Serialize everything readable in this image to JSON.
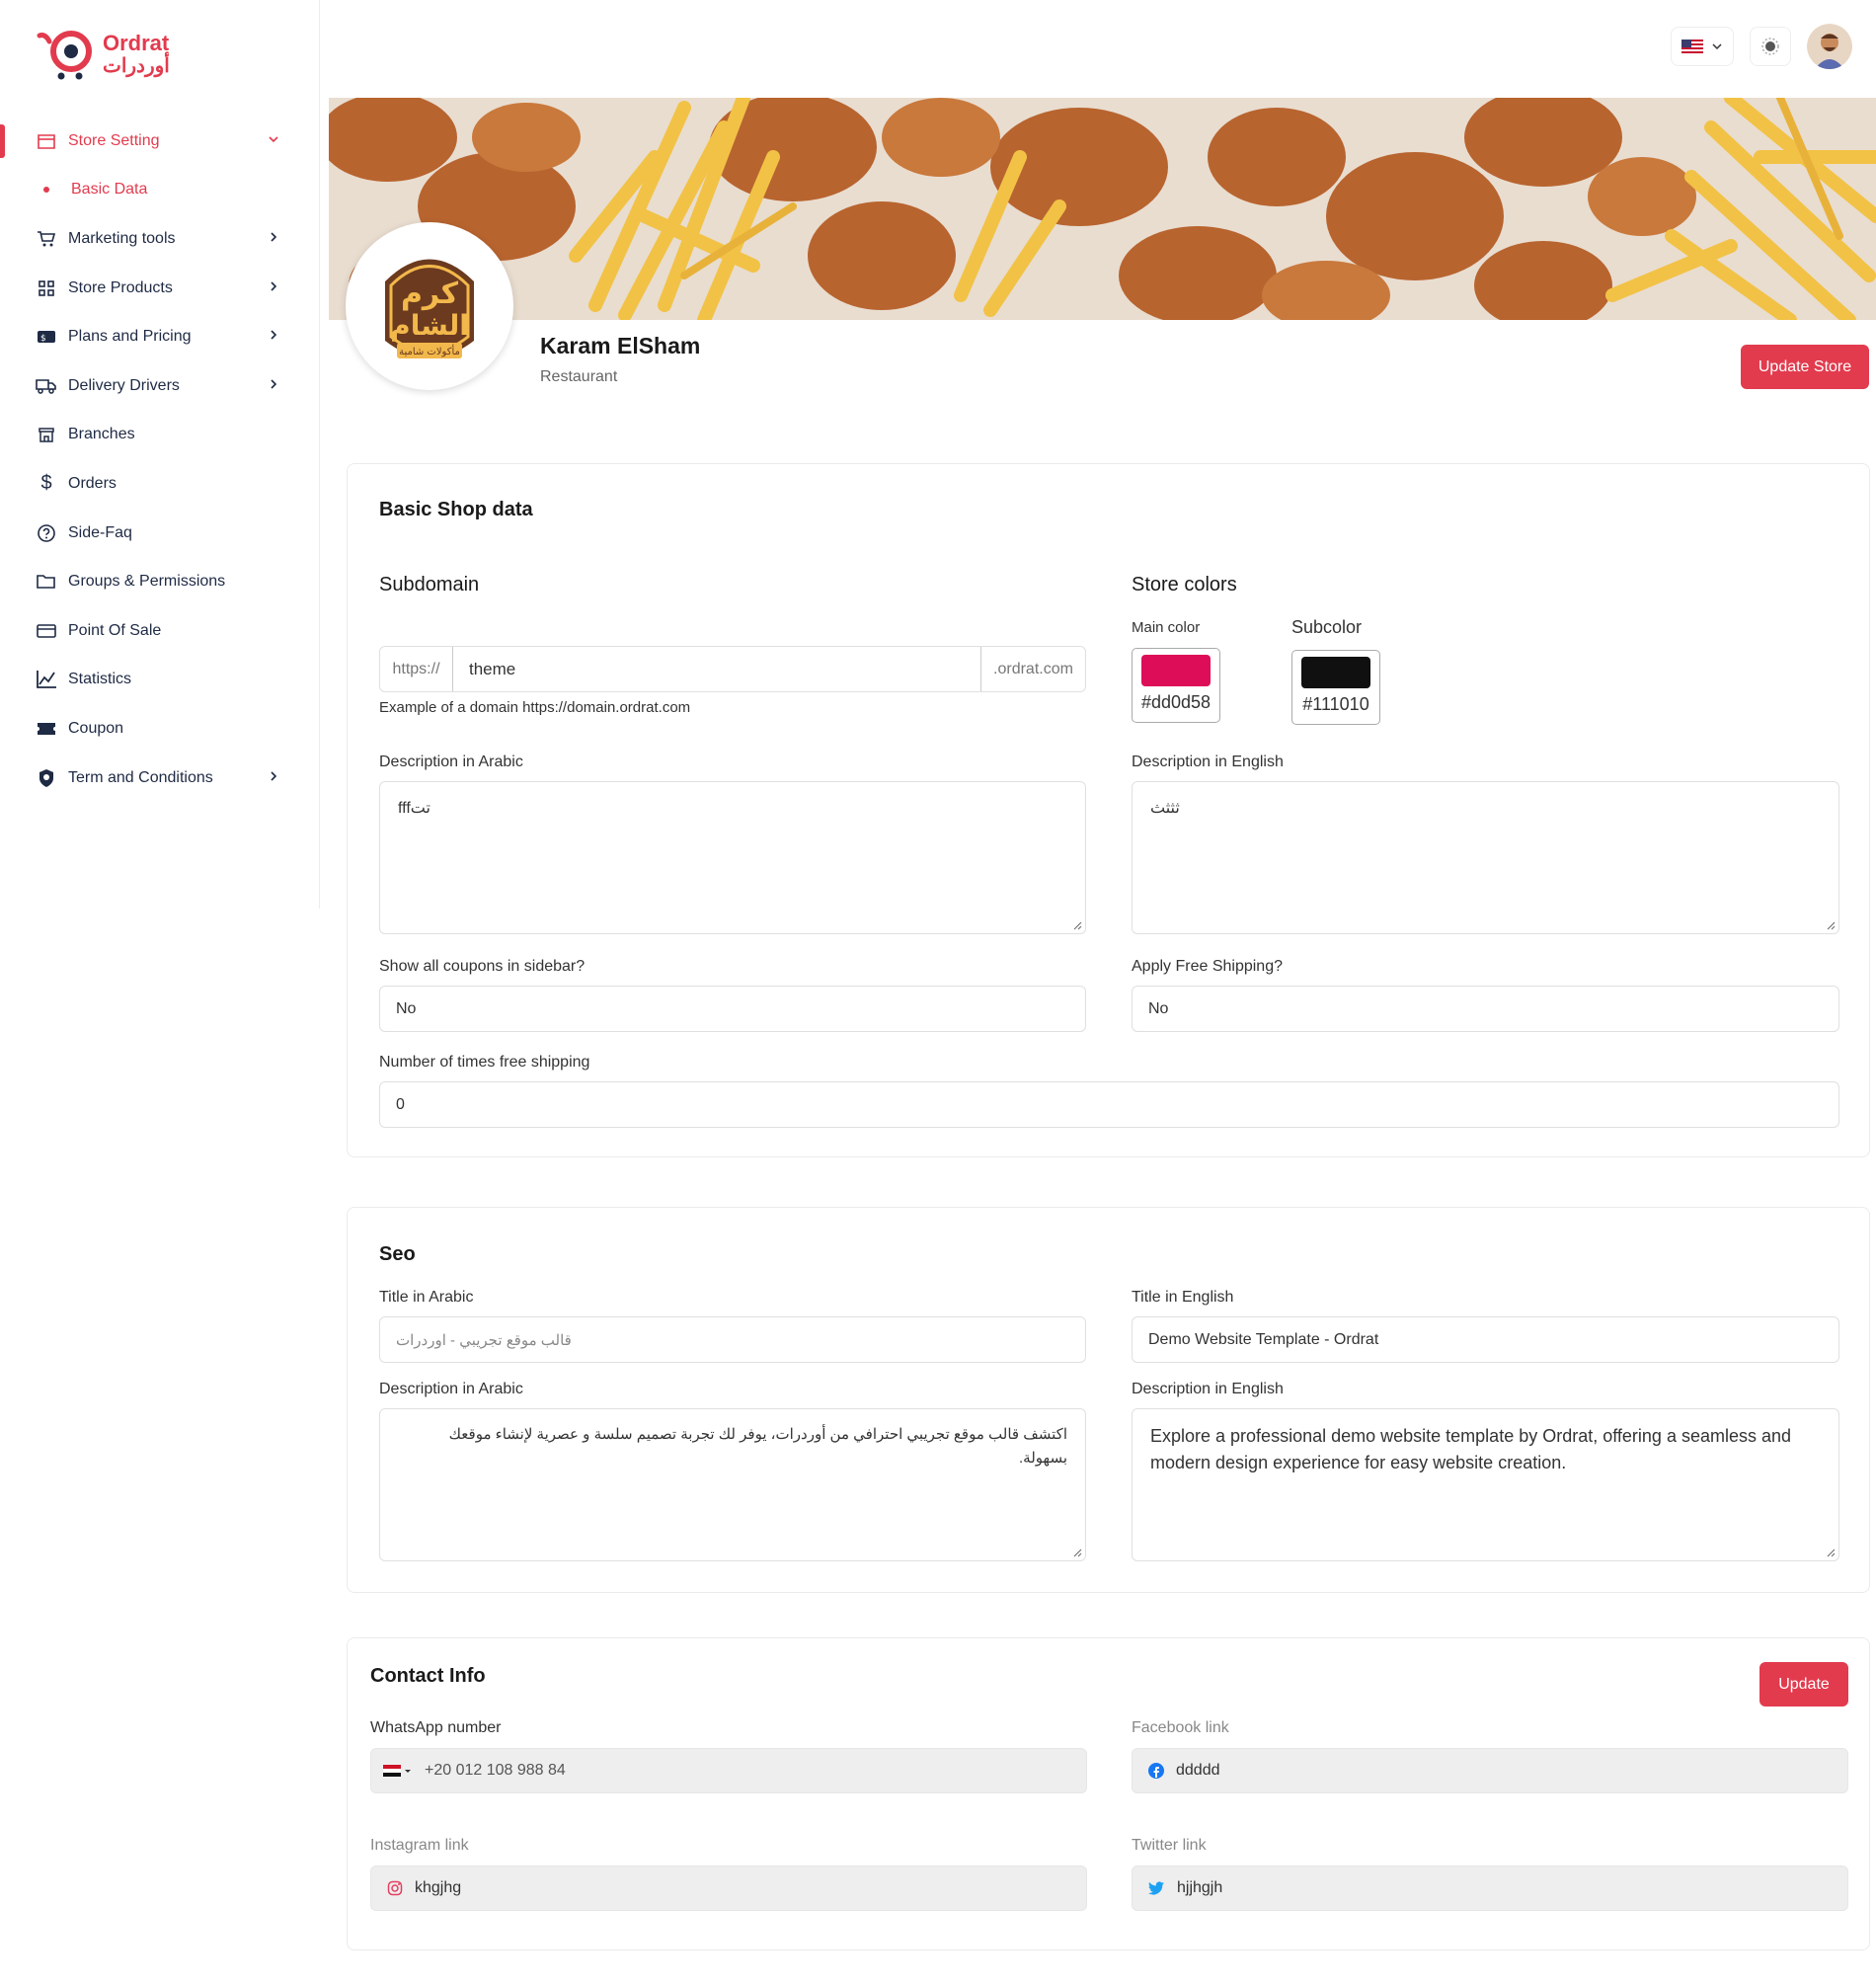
{
  "brand": {
    "name_en": "Ordrat",
    "name_ar": "أوردرات"
  },
  "sidebar": {
    "items": [
      {
        "label": "Store Setting",
        "icon": "store-icon"
      },
      {
        "label": "Basic Data"
      },
      {
        "label": "Marketing tools",
        "icon": "cart-icon"
      },
      {
        "label": "Store Products",
        "icon": "grid-icon"
      },
      {
        "label": "Plans and Pricing",
        "icon": "pricing-icon"
      },
      {
        "label": "Delivery Drivers",
        "icon": "truck-icon"
      },
      {
        "label": "Branches",
        "icon": "shop-icon"
      },
      {
        "label": "Orders",
        "icon": "dollar-icon"
      },
      {
        "label": "Side-Faq",
        "icon": "help-icon"
      },
      {
        "label": "Groups & Permissions",
        "icon": "folder-icon"
      },
      {
        "label": "Point Of Sale",
        "icon": "pos-icon"
      },
      {
        "label": "Statistics",
        "icon": "chart-icon"
      },
      {
        "label": "Coupon",
        "icon": "ticket-icon"
      },
      {
        "label": "Term and Conditions",
        "icon": "shield-icon"
      }
    ]
  },
  "store": {
    "name": "Karam ElSham",
    "type": "Restaurant",
    "update_label": "Update Store",
    "logo_text_top": "كرم",
    "logo_text_mid": "الشام",
    "logo_text_bottom": "مأكولات شامية"
  },
  "basic": {
    "title": "Basic Shop data",
    "subdomain_heading": "Subdomain",
    "prefix": "https://",
    "subdomain_value": "theme",
    "suffix": ".ordrat.com",
    "example": "Example of a domain https://domain.ordrat.com",
    "colors_heading": "Store colors",
    "main_color_label": "Main color",
    "main_color": "#dd0d58",
    "sub_color_label": "Subcolor",
    "sub_color": "#111010",
    "desc_ar_label": "Description in Arabic",
    "desc_ar_value": "fffتت",
    "desc_en_label": "Description in English",
    "desc_en_value": "ثثثث",
    "coupons_label": "Show all coupons in sidebar?",
    "coupons_value": "No",
    "free_ship_label": "Apply Free Shipping?",
    "free_ship_value": "No",
    "free_times_label": "Number of times free shipping",
    "free_times_value": "0"
  },
  "seo": {
    "title": "Seo",
    "title_ar_label": "Title in Arabic",
    "title_ar_value": "قالب موقع تجريبي - اوردرات",
    "title_en_label": "Title in English",
    "title_en_value": "Demo Website Template - Ordrat",
    "desc_ar_label": "Description in Arabic",
    "desc_ar_value": "اكتشف قالب موقع تجريبي احترافي من أوردرات، يوفر لك تجربة تصميم سلسة و عصرية لإنشاء موقعك بسهولة.",
    "desc_en_label": "Description in English",
    "desc_en_value": "Explore a professional demo website template by Ordrat, offering a seamless and modern design experience for easy website creation."
  },
  "contact": {
    "title": "Contact Info",
    "update_label": "Update",
    "whatsapp_label": "WhatsApp number",
    "whatsapp_value": "+20 012 108 988 84",
    "facebook_label": "Facebook link",
    "facebook_value": "ddddd",
    "instagram_label": "Instagram link",
    "instagram_value": "khgjhg",
    "twitter_label": "Twitter link",
    "twitter_value": "hjjhgjh"
  },
  "colors": {
    "accent": "#e23b4e",
    "nav_text": "#1f2a44"
  }
}
